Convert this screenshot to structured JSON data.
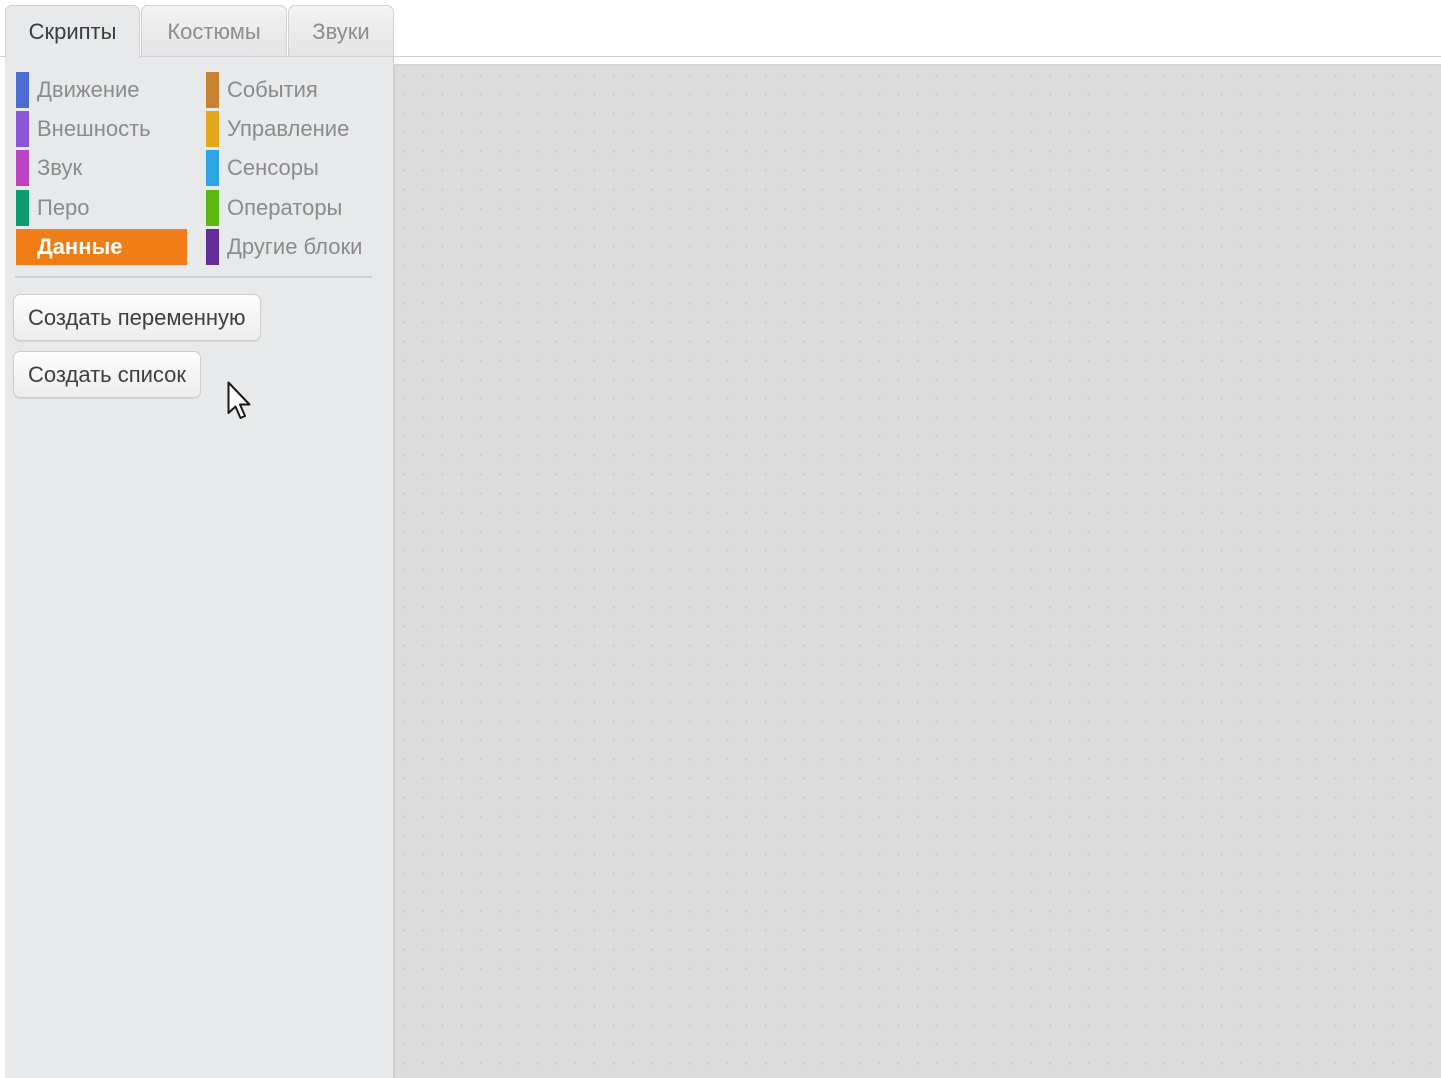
{
  "tabs": [
    {
      "label": "Скрипты",
      "active": true
    },
    {
      "label": "Костюмы",
      "active": false
    },
    {
      "label": "Звуки",
      "active": false
    }
  ],
  "categories": {
    "left": [
      {
        "label": "Движение",
        "color": "#4a6cd4"
      },
      {
        "label": "Внешность",
        "color": "#8a55d7"
      },
      {
        "label": "Звук",
        "color": "#bb42c3"
      },
      {
        "label": "Перо",
        "color": "#0e9a6c"
      },
      {
        "label": "Данные",
        "color": "#ee7d16",
        "active": true
      }
    ],
    "right": [
      {
        "label": "События",
        "color": "#c88330"
      },
      {
        "label": "Управление",
        "color": "#e1a91a"
      },
      {
        "label": "Сенсоры",
        "color": "#2ca5e2"
      },
      {
        "label": "Операторы",
        "color": "#5cb712"
      },
      {
        "label": "Другие блоки",
        "color": "#632d99"
      }
    ]
  },
  "buttons": {
    "make_variable": "Создать переменную",
    "make_list": "Создать список"
  },
  "theme": {
    "active_category_bg": "#ee7d16",
    "palette_bg": "#e8e9ea",
    "script_area_bg": "#dcdcdc"
  },
  "icons": {
    "cursor": "arrow-cursor-icon"
  }
}
